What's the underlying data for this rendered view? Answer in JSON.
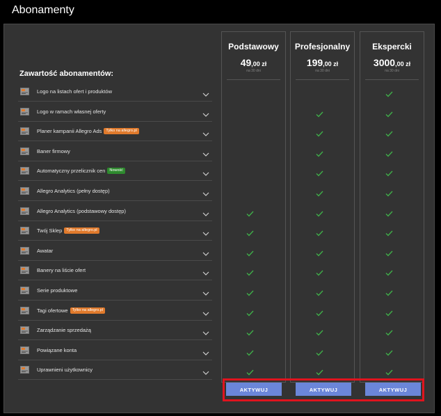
{
  "window": {
    "title": "Abonamenty"
  },
  "section_title": "Zawartość abonamentów:",
  "features": [
    {
      "label": "Logo na listach ofert i produktów",
      "icon": "logo-list-icon",
      "badge": null,
      "badge_color": null,
      "checks": [
        false,
        false,
        true
      ]
    },
    {
      "label": "Logo w ramach własnej oferty",
      "icon": "logo-offer-icon",
      "badge": null,
      "badge_color": null,
      "checks": [
        false,
        true,
        true
      ]
    },
    {
      "label": "Planer kampanii Allegro Ads",
      "icon": "campaign-planner-icon",
      "badge": "Tylko na allegro.pl",
      "badge_color": "orange",
      "checks": [
        false,
        true,
        true
      ]
    },
    {
      "label": "Baner firmowy",
      "icon": "banner-icon",
      "badge": null,
      "badge_color": null,
      "checks": [
        false,
        true,
        true
      ]
    },
    {
      "label": "Automatyczny przelicznik cen",
      "icon": "price-converter-icon",
      "badge": "Nowość",
      "badge_color": "green",
      "checks": [
        false,
        true,
        true
      ]
    },
    {
      "label": "Allegro Analytics (pełny dostęp)",
      "icon": "analytics-full-icon",
      "badge": null,
      "badge_color": null,
      "checks": [
        false,
        true,
        true
      ]
    },
    {
      "label": "Allegro Analytics (podstawowy dostęp)",
      "icon": "analytics-basic-icon",
      "badge": null,
      "badge_color": null,
      "checks": [
        true,
        true,
        true
      ]
    },
    {
      "label": "Twój Sklep",
      "icon": "shop-icon",
      "badge": "Tylko na allegro.pl",
      "badge_color": "orange",
      "checks": [
        true,
        true,
        true
      ]
    },
    {
      "label": "Awatar",
      "icon": "avatar-icon",
      "badge": null,
      "badge_color": null,
      "checks": [
        true,
        true,
        true
      ]
    },
    {
      "label": "Banery na liście ofert",
      "icon": "list-banner-icon",
      "badge": null,
      "badge_color": null,
      "checks": [
        true,
        true,
        true
      ]
    },
    {
      "label": "Serie produktowe",
      "icon": "product-series-icon",
      "badge": null,
      "badge_color": null,
      "checks": [
        true,
        true,
        true
      ]
    },
    {
      "label": "Tagi ofertowe",
      "icon": "offer-tags-icon",
      "badge": "Tylko na allegro.pl",
      "badge_color": "orange",
      "checks": [
        true,
        true,
        true
      ]
    },
    {
      "label": "Zarządzanie sprzedażą",
      "icon": "sales-management-icon",
      "badge": null,
      "badge_color": null,
      "checks": [
        true,
        true,
        true
      ]
    },
    {
      "label": "Powiązane konta",
      "icon": "linked-accounts-icon",
      "badge": null,
      "badge_color": null,
      "checks": [
        true,
        true,
        true
      ]
    },
    {
      "label": "Uprawnieni użytkownicy",
      "icon": "authorized-users-icon",
      "badge": null,
      "badge_color": null,
      "checks": [
        true,
        true,
        true
      ]
    }
  ],
  "plans": [
    {
      "name": "Podstawowy",
      "price_main": "49",
      "price_decimal": ",00 zł",
      "period": "na 30 dni",
      "button": "AKTYWUJ"
    },
    {
      "name": "Profesjonalny",
      "price_main": "199",
      "price_decimal": ",00 zł",
      "period": "na 30 dni",
      "button": "AKTYWUJ"
    },
    {
      "name": "Ekspercki",
      "price_main": "3000",
      "price_decimal": ",00 zł",
      "period": "na 30 dni",
      "button": "AKTYWUJ"
    }
  ],
  "colors": {
    "background": "#000000",
    "panel": "#333333",
    "check": "#3fae49",
    "button": "#6b86d9",
    "highlight": "#e0141e",
    "badge_orange": "#e07a2c",
    "badge_green": "#2e8a2e"
  }
}
